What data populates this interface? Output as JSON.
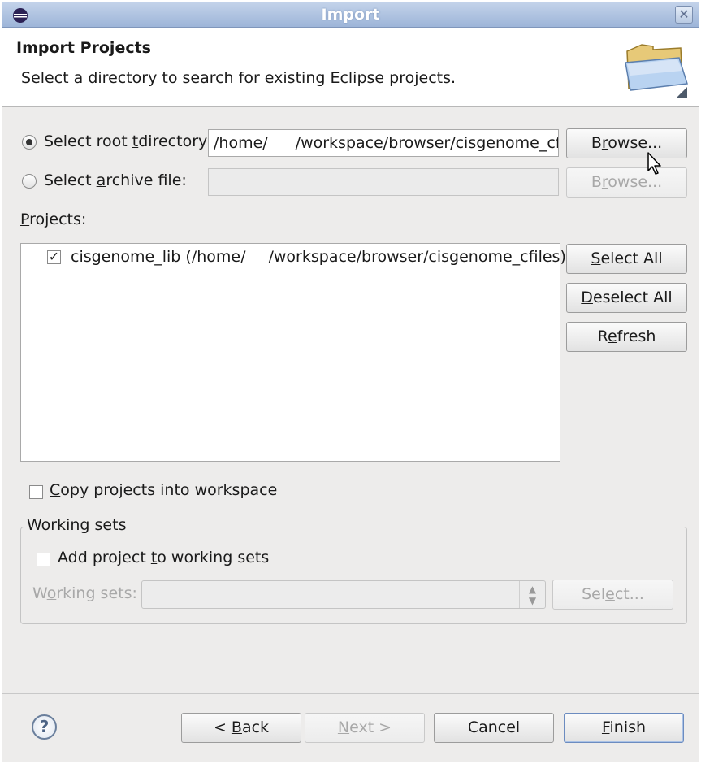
{
  "window": {
    "title": "Import",
    "close_glyph": "✕",
    "app_icon": "eclipse-icon"
  },
  "header": {
    "title": "Import Projects",
    "description": "Select a directory to search for existing Eclipse projects.",
    "icon": "folder-icon"
  },
  "source": {
    "root_dir": {
      "label_pre": "Select root ",
      "label_mnemonic": "t",
      "label_post": "directory:",
      "checked": true,
      "value_pre": "/home/",
      "value_post": "/workspace/browser/cisgenome_cfil"
    },
    "archive": {
      "label_pre": "Select ",
      "label_mnemonic": "a",
      "label_post": "rchive file:",
      "checked": false,
      "value": ""
    },
    "browse_root": {
      "pre": "B",
      "mnemonic": "r",
      "post": "owse..."
    },
    "browse_archive": {
      "pre": "B",
      "mnemonic": "r",
      "post": "owse..."
    }
  },
  "projects": {
    "label_mnemonic": "P",
    "label_post": "rojects:",
    "items": [
      {
        "checked": true,
        "check_glyph": "✓",
        "text_pre": "cisgenome_lib (/home/",
        "text_post": "/workspace/browser/cisgenome_cfiles)"
      }
    ],
    "select_all": {
      "mnemonic": "S",
      "post": "elect All"
    },
    "deselect_all": {
      "mnemonic": "D",
      "post": "eselect All"
    },
    "refresh": {
      "pre": "R",
      "mnemonic": "e",
      "post": "fresh"
    }
  },
  "options": {
    "copy": {
      "mnemonic": "C",
      "post": "opy projects into workspace",
      "checked": false
    }
  },
  "working_sets": {
    "title": "Working sets",
    "add": {
      "pre": "Add project ",
      "mnemonic": "t",
      "post": "o working sets",
      "checked": false
    },
    "label": {
      "pre": "W",
      "mnemonic": "o",
      "post": "rking sets:"
    },
    "combo_value": "",
    "select_btn": {
      "pre": "Sel",
      "mnemonic": "e",
      "post": "ct..."
    }
  },
  "footer": {
    "help_glyph": "?",
    "back": {
      "pre": "< ",
      "mnemonic": "B",
      "post": "ack"
    },
    "next": {
      "mnemonic": "N",
      "post": "ext >"
    },
    "cancel": "Cancel",
    "finish": {
      "mnemonic": "F",
      "post": "inish"
    }
  }
}
